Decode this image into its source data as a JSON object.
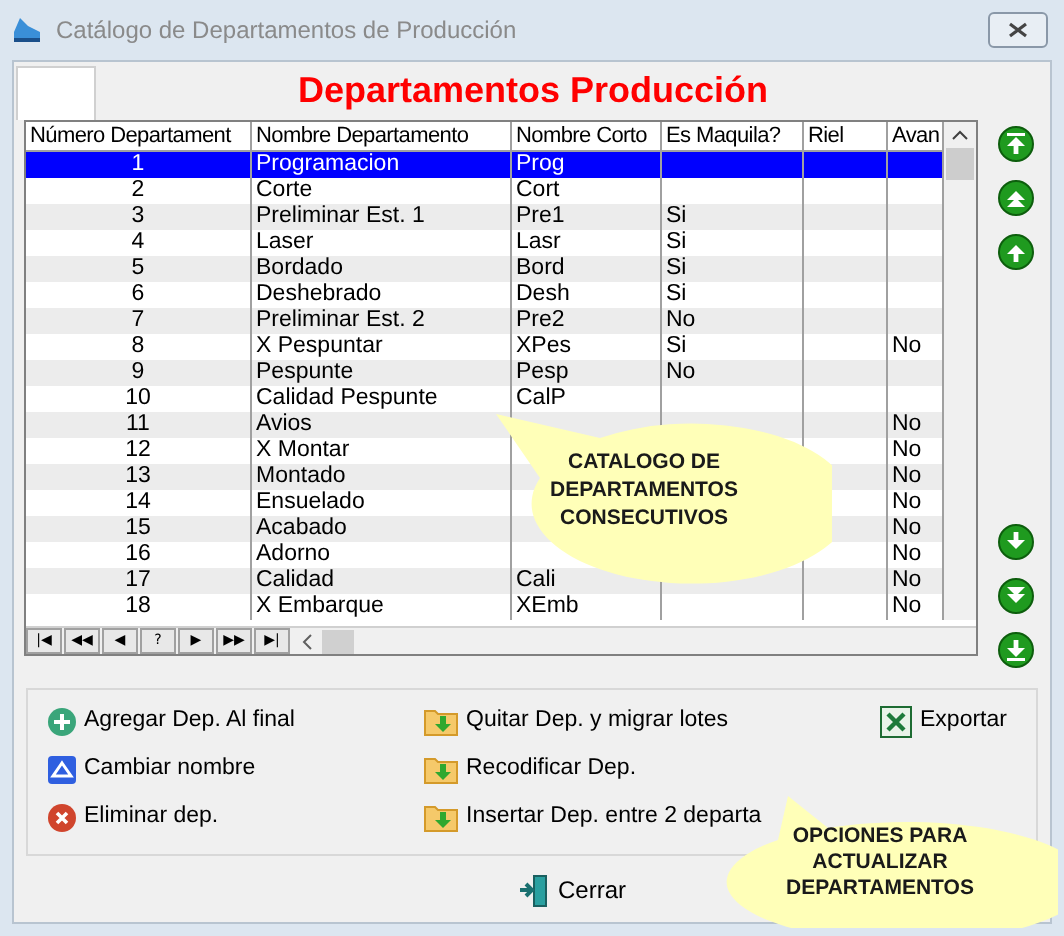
{
  "window": {
    "title": "Catálogo de Departamentos de Producción"
  },
  "heading": "Departamentos Producción",
  "table": {
    "columns": [
      "Número Departament",
      "Nombre Departamento",
      "Nombre Corto",
      "Es Maquila?",
      "Riel",
      "Avan"
    ],
    "rows": [
      {
        "numero": "1",
        "nombre": "Programacion",
        "corto": "Prog",
        "selected": true
      },
      {
        "numero": "2",
        "nombre": "Corte",
        "corto": "Cort",
        "selected": false
      },
      {
        "numero": "3",
        "nombre": "Preliminar Est. 1",
        "corto": "Pre1",
        "maquila": "Si",
        "selected": false
      },
      {
        "numero": "4",
        "nombre": "Laser",
        "corto": "Lasr",
        "maquila": "Si",
        "selected": false
      },
      {
        "numero": "5",
        "nombre": "Bordado",
        "corto": "Bord",
        "maquila": "Si",
        "selected": false
      },
      {
        "numero": "6",
        "nombre": "Deshebrado",
        "corto": "Desh",
        "maquila": "Si",
        "selected": false
      },
      {
        "numero": "7",
        "nombre": "Preliminar Est. 2",
        "corto": "Pre2",
        "maquila": "No",
        "selected": false
      },
      {
        "numero": "8",
        "nombre": "X Pespuntar",
        "corto": "XPes",
        "maquila": "Si",
        "avance": "No",
        "selected": false
      },
      {
        "numero": "9",
        "nombre": "Pespunte",
        "corto": "Pesp",
        "maquila": "No",
        "selected": false
      },
      {
        "numero": "10",
        "nombre": "Calidad Pespunte",
        "corto": "CalP",
        "selected": false
      },
      {
        "numero": "11",
        "nombre": "Avios",
        "avance": "No",
        "selected": false
      },
      {
        "numero": "12",
        "nombre": "X Montar",
        "avance": "No",
        "selected": false
      },
      {
        "numero": "13",
        "nombre": "Montado",
        "avance": "No",
        "selected": false
      },
      {
        "numero": "14",
        "nombre": "Ensuelado",
        "avance": "No",
        "selected": false
      },
      {
        "numero": "15",
        "nombre": "Acabado",
        "avance": "No",
        "selected": false
      },
      {
        "numero": "16",
        "nombre": "Adorno",
        "avance": "No",
        "selected": false
      },
      {
        "numero": "17",
        "nombre": "Calidad",
        "corto": "Cali",
        "avance": "No",
        "selected": false
      },
      {
        "numero": "18",
        "nombre": "X Embarque",
        "corto": "XEmb",
        "avance": "No",
        "selected": false
      }
    ]
  },
  "pager": [
    "|◀",
    "◀◀",
    "◀",
    "?",
    "▶",
    "▶▶",
    "▶|"
  ],
  "callouts": [
    "CATALOGO DE DEPARTAMENTOS CONSECUTIVOS",
    "OPCIONES PARA ACTUALIZAR DEPARTAMENTOS"
  ],
  "options": [
    [
      {
        "kind": "add",
        "label": "Agregar Dep. Al final"
      },
      {
        "kind": "rename",
        "label": "Cambiar nombre"
      },
      {
        "kind": "delete",
        "label": "Eliminar dep."
      }
    ],
    [
      {
        "kind": "folder",
        "label": "Quitar Dep. y migrar lotes"
      },
      {
        "kind": "folder",
        "label": "Recodificar Dep."
      },
      {
        "kind": "folder",
        "label": "Insertar Dep. entre 2 departa"
      }
    ],
    [
      {
        "kind": "excel",
        "label": "Exportar"
      }
    ]
  ],
  "close_button": "Cerrar"
}
